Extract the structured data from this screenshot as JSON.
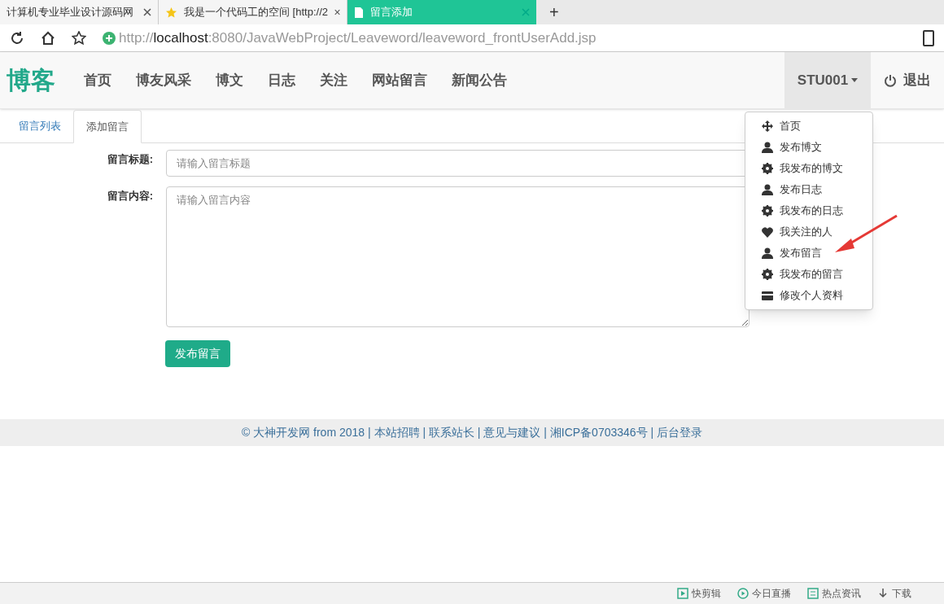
{
  "browser": {
    "tabs": [
      {
        "title": "计算机专业毕业设计源码网",
        "kind": "plain",
        "selected": false
      },
      {
        "title": "我是一个代码工的空间 [http://2",
        "kind": "bookmarked",
        "selected": false
      },
      {
        "title": "留言添加",
        "kind": "document",
        "selected": true
      }
    ],
    "new_tab": "+",
    "address": {
      "host": "http://localhost",
      "rest": ":8080/JavaWebProject/Leaveword/leaveword_frontUserAdd.jsp"
    }
  },
  "navbar": {
    "brand": "博客",
    "links": [
      "首页",
      "博友风采",
      "博文",
      "日志",
      "关注",
      "网站留言",
      "新闻公告"
    ],
    "user": "STU001",
    "logout": "退出",
    "menu": [
      {
        "label": "首页",
        "kind": "move"
      },
      {
        "label": "发布博文",
        "kind": "user"
      },
      {
        "label": "我发布的博文",
        "kind": "gear"
      },
      {
        "label": "发布日志",
        "kind": "user"
      },
      {
        "label": "我发布的日志",
        "kind": "gear"
      },
      {
        "label": "我关注的人",
        "kind": "heart"
      },
      {
        "label": "发布留言",
        "kind": "user"
      },
      {
        "label": "我发布的留言",
        "kind": "gear"
      },
      {
        "label": "修改个人资料",
        "kind": "card"
      }
    ]
  },
  "page_tabs": [
    {
      "label": "留言列表",
      "selected": false
    },
    {
      "label": "添加留言",
      "selected": true
    }
  ],
  "form": {
    "fields": [
      {
        "label": "留言标题:",
        "placeholder": "请输入留言标题",
        "kind": "input"
      },
      {
        "label": "留言内容:",
        "placeholder": "请输入留言内容",
        "kind": "textarea"
      }
    ],
    "submit": "发布留言"
  },
  "footer": "© 大神开发网 from 2018 | 本站招聘 | 联系站长 | 意见与建议 | 湘ICP备0703346号 | 后台登录",
  "status_bar": [
    "快剪辑",
    "今日直播",
    "热点资讯",
    "下载"
  ]
}
